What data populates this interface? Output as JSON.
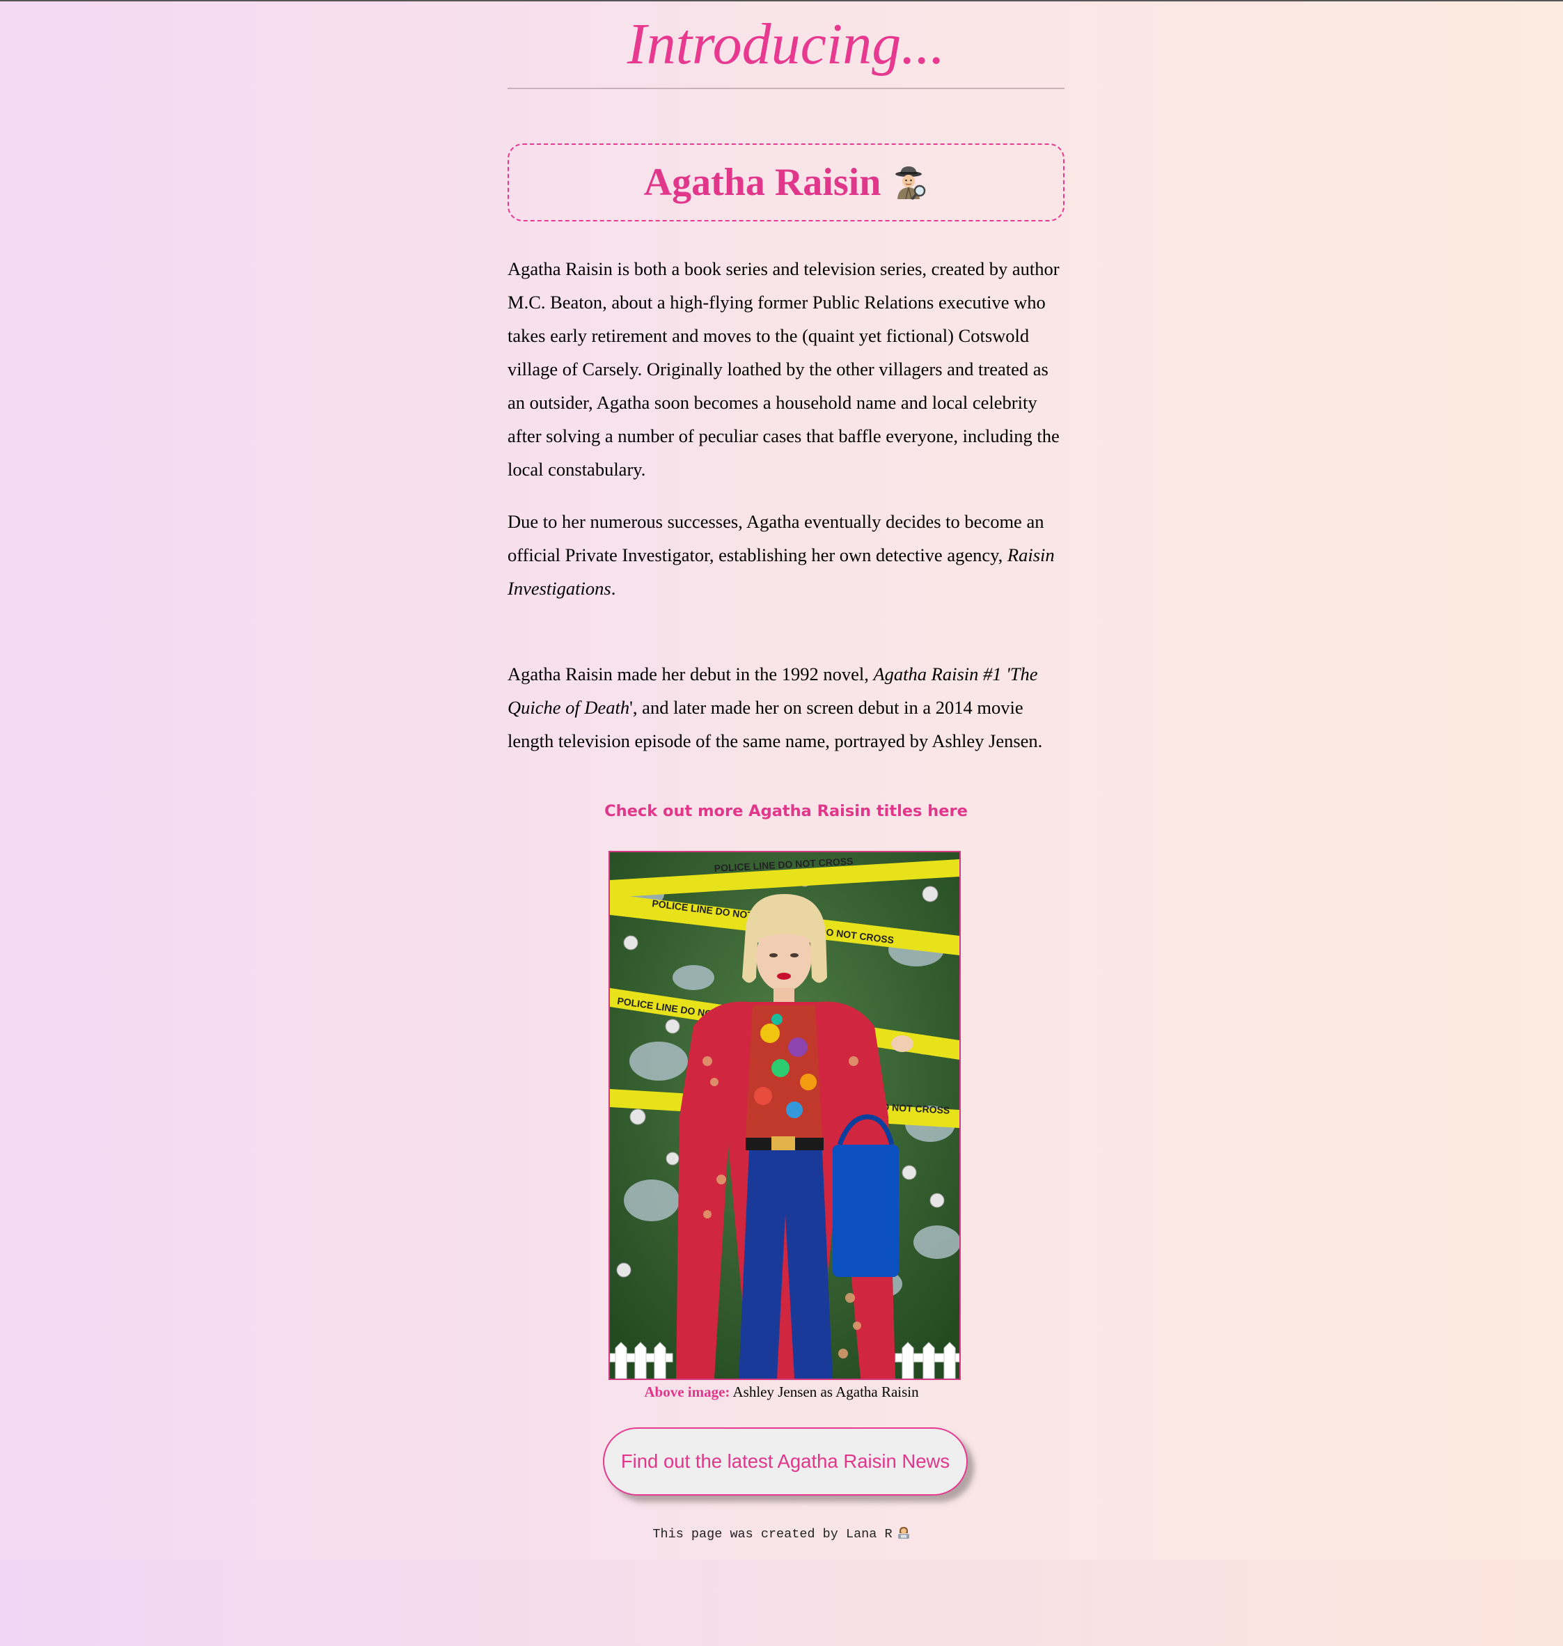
{
  "header": {
    "title": "Introducing..."
  },
  "hero": {
    "name": "Agatha Raisin",
    "icon": "detective-icon"
  },
  "article": {
    "paragraph1": "Agatha Raisin is both a book series and television series, created by author M.C. Beaton, about a high-flying former Public Relations executive who takes early retirement and moves to the (quaint yet fictional) Cotswold village of Carsely. Originally loathed by the other villagers and treated as an outsider, Agatha soon becomes a household name and local celebrity after solving a number of peculiar cases that baffle everyone, including the local constabulary.",
    "paragraph2_text": "Due to her numerous successes, Agatha eventually decides to become an official Private Investigator, establishing her own detective agency, ",
    "paragraph2_italic": "Raisin Investigations",
    "paragraph2_end": ".",
    "paragraph3_text": "Agatha Raisin made her debut in the 1992 novel, ",
    "paragraph3_italic": "Agatha Raisin #1 'The Quiche of Death",
    "paragraph3_after_italic": "', and later made her on screen debut in a 2014 movie length television episode of the same name, portrayed by Ashley Jensen."
  },
  "titles_link": {
    "label": "Check out more Agatha Raisin titles here"
  },
  "photo": {
    "caption_label": "Above image:",
    "caption_text": " Ashley Jensen as Agatha Raisin"
  },
  "news_button": {
    "label": "Find out the latest Agatha Raisin News"
  },
  "footer": {
    "text": "This page was created by Lana R",
    "icon": "woman-technologist-icon"
  },
  "colors": {
    "accent": "#e6398f",
    "button_bg": "#efefef",
    "gradient_left": "#f4d9f3",
    "gradient_right": "#fcebe0"
  }
}
